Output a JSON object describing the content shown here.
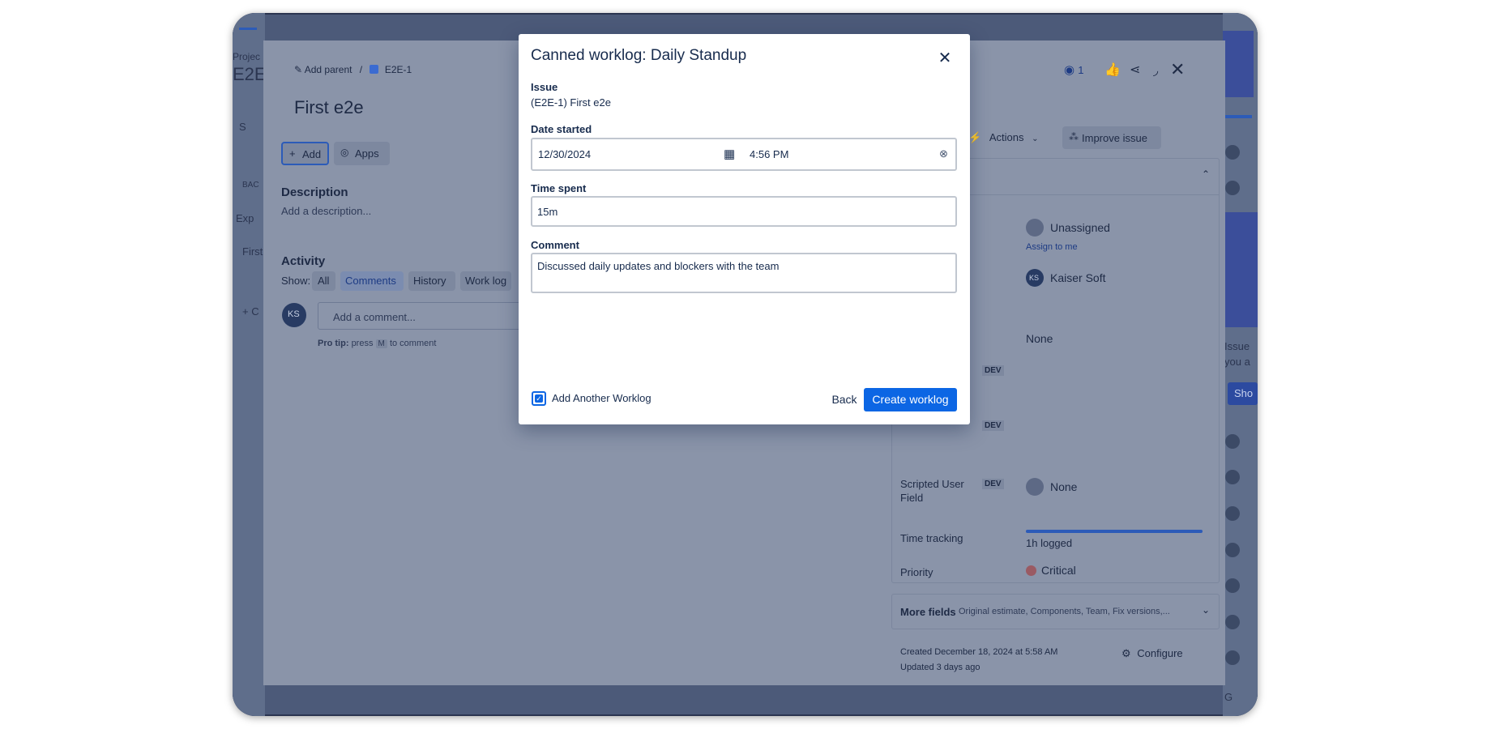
{
  "background": {
    "project_label": "Projec",
    "project_key": "E2E",
    "search_stub": "S",
    "back_stub": "BAC",
    "exp_stub": "Exp",
    "first_stub": "First",
    "create_stub": "+ C",
    "right_issue_stub": "Issue",
    "right_you_stub": "you a",
    "right_show_stub": "Sho",
    "bottom_stub": "G"
  },
  "issue": {
    "breadcrumb_add_parent": "Add parent",
    "breadcrumb_sep": "/",
    "breadcrumb_key": "E2E-1",
    "watch_count": "1",
    "title": "First e2e",
    "add_button": "Add",
    "apps_button": "Apps",
    "description_heading": "Description",
    "description_placeholder": "Add a description...",
    "activity_heading": "Activity",
    "show_label": "Show:",
    "filters": [
      "All",
      "Comments",
      "History",
      "Work log"
    ],
    "avatar_initials": "KS",
    "comment_placeholder": "Add a comment...",
    "pro_tip_bold": "Pro tip:",
    "pro_tip_press": "press",
    "pro_tip_key": "M",
    "pro_tip_suffix": "to comment",
    "actions_button": "Actions",
    "improve_button": "Improve issue",
    "assignee_value": "Unassigned",
    "assign_to_me": "Assign to me",
    "reporter_value": "Kaiser Soft",
    "reporter_initials": "KS",
    "none_value": "None",
    "dev_badge": "DEV",
    "scripted_user_field_label": "Scripted User Field",
    "scripted_user_field_value": "None",
    "time_tracking_label": "Time tracking",
    "time_tracking_value": "1h logged",
    "time_tracking_progress": 1.0,
    "priority_label": "Priority",
    "priority_value": "Critical",
    "more_fields_label": "More fields",
    "more_fields_hint": "Original estimate, Components, Team, Fix versions,...",
    "created_text": "Created December 18, 2024 at 5:58 AM",
    "updated_text": "Updated 3 days ago",
    "configure_button": "Configure"
  },
  "modal": {
    "title": "Canned worklog: Daily Standup",
    "issue_label": "Issue",
    "issue_value": "(E2E-1) First e2e",
    "date_label": "Date started",
    "date_value": "12/30/2024",
    "time_value": "4:56 PM",
    "time_spent_label": "Time spent",
    "time_spent_value": "15m",
    "comment_label": "Comment",
    "comment_value": "Discussed daily updates and blockers with the team",
    "add_another_label": "Add Another Worklog",
    "add_another_checked": true,
    "back_button": "Back",
    "create_button": "Create worklog"
  },
  "colors": {
    "primary": "#0c66e4",
    "overlay": "#8a94a9",
    "critical": "#e5493a"
  }
}
